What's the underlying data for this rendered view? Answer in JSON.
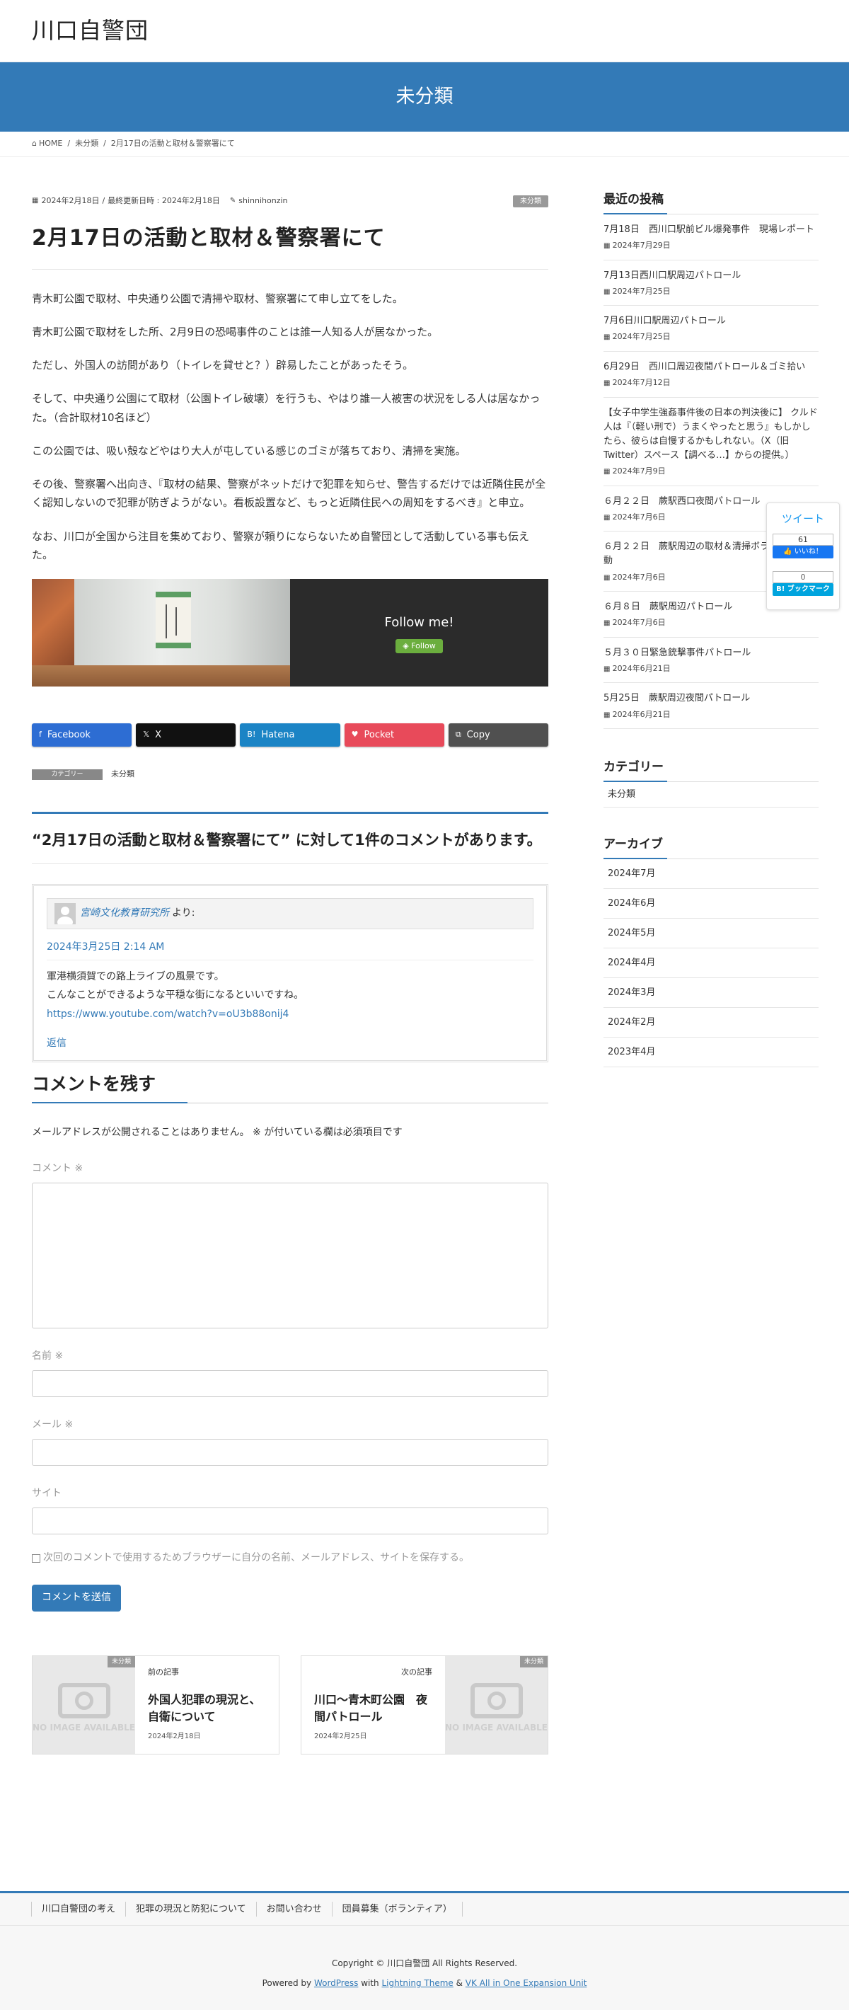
{
  "site": {
    "title": "川口自警団"
  },
  "banner": {
    "title": "未分類"
  },
  "breadcrumb": {
    "home_icon": "home-icon",
    "home": "HOME",
    "category": "未分類",
    "current": "2月17日の活動と取材＆警察署にて",
    "separator": "/"
  },
  "post": {
    "published": "2024年2月18日",
    "updated": "最終更新日時 : 2024年2月18日",
    "author": "shinnihonzin",
    "category_badge": "未分類",
    "title": "2月17日の活動と取材＆警察署にて",
    "paragraphs": [
      "青木町公園で取材、中央通り公園で清掃や取材、警察署にて申し立てをした。",
      "青木町公園で取材をした所、2月9日の恐喝事件のことは誰一人知る人が居なかった。",
      "ただし、外国人の訪問があり（トイレを貸せと？）辟易したことがあったそう。",
      "そして、中央通り公園にて取材（公園トイレ破壊）を行うも、やはり誰一人被害の状況をしる人は居なかった。（合計取材10名ほど）",
      "この公園では、吸い殻などやはり大人が屯している感じのゴミが落ちており、清掃を実施。",
      "その後、警察署へ出向き、『取材の結果、警察がネットだけで犯罪を知らせ、警告するだけでは近隣住民が全く認知しないので犯罪が防ぎようがない。看板設置など、もっと近隣住民への周知をするべき』と申立。",
      "なお、川口が全国から注目を集めており、警察が頼りにならないため自警団として活動している事も伝えた。"
    ],
    "follow": {
      "text": "Follow me!",
      "button": "Follow"
    },
    "share": [
      {
        "label": "Facebook",
        "color": "#2d6dd3",
        "icon": "facebook-icon",
        "glyph": "f"
      },
      {
        "label": "X",
        "color": "#111111",
        "icon": "x-icon",
        "glyph": "𝕏"
      },
      {
        "label": "Hatena",
        "color": "#1b84c5",
        "icon": "hatena-icon",
        "glyph": "B!"
      },
      {
        "label": "Pocket",
        "color": "#e84a5a",
        "icon": "pocket-icon",
        "glyph": "♥"
      },
      {
        "label": "Copy",
        "color": "#505050",
        "icon": "copy-icon",
        "glyph": "⧉"
      }
    ],
    "category_label": "カテゴリー",
    "category_value": "未分類"
  },
  "comments": {
    "title": "“2月17日の活動と取材＆警察署にて” に対して1件のコメントがあります。",
    "author": "宮崎文化教育研究所",
    "author_suffix": "より:",
    "date": "2024年3月25日 2:14 AM",
    "lines": [
      "軍港横須賀での路上ライブの風景です。",
      "こんなことができるような平穏な街になるといいですね。"
    ],
    "link": "https://www.youtube.com/watch?v=oU3b88onij4",
    "reply": "返信"
  },
  "form": {
    "title": "コメントを残す",
    "notes": "メールアドレスが公開されることはありません。 ※ が付いている欄は必須項目です",
    "comment_label": "コメント ※",
    "name_label": "名前 ※",
    "email_label": "メール ※",
    "site_label": "サイト",
    "save_label": "次回のコメントで使用するためブラウザーに自分の名前、メールアドレス、サイトを保存する。",
    "submit": "コメントを送信"
  },
  "post_nav": {
    "prev": {
      "label": "前の記事",
      "title": "外国人犯罪の現況と、自衛について",
      "date": "2024年2月18日",
      "badge": "未分類"
    },
    "next": {
      "label": "次の記事",
      "title": "川口〜青木町公園　夜間パトロール",
      "date": "2024年2月25日",
      "badge": "未分類"
    },
    "noimage": "NO IMAGE AVAILABLE"
  },
  "sidebar": {
    "recent_title": "最近の投稿",
    "recent": [
      {
        "title": "7月18日　西川口駅前ビル爆発事件　現場レポート",
        "date": "2024年7月29日"
      },
      {
        "title": "7月13日西川口駅周辺パトロール",
        "date": "2024年7月25日"
      },
      {
        "title": "7月6日川口駅周辺パトロール",
        "date": "2024年7月25日"
      },
      {
        "title": "6月29日　西川口周辺夜間パトロール＆ゴミ拾い",
        "date": "2024年7月12日"
      },
      {
        "title": "【女子中学生強姦事件後の日本の判決後に】 クルド人は『（軽い刑で）うまくやったと思う』もしかしたら、彼らは自慢するかもしれない。（X（旧Twitter）スペース【調べる…】からの提供。）",
        "date": "2024年7月9日"
      },
      {
        "title": "６月２２日　蕨駅西口夜間パトロール",
        "date": "2024年7月6日"
      },
      {
        "title": "６月２２日　蕨駅周辺の取材＆清掃ボランティア活動",
        "date": "2024年7月6日"
      },
      {
        "title": "６月８日　蕨駅周辺パトロール",
        "date": "2024年7月6日"
      },
      {
        "title": "５月３０日緊急銃撃事件パトロール",
        "date": "2024年6月21日"
      },
      {
        "title": "5月25日　蕨駅周辺夜間パトロール",
        "date": "2024年6月21日"
      }
    ],
    "category_title": "カテゴリー",
    "categories": [
      "未分類"
    ],
    "archive_title": "アーカイブ",
    "archives": [
      "2024年7月",
      "2024年6月",
      "2024年5月",
      "2024年4月",
      "2024年3月",
      "2024年2月",
      "2023年4月"
    ]
  },
  "floating_share": {
    "tweet": "ツイート",
    "fb_count": "61",
    "fb_like": "👍 いいね！",
    "hatena_count": "0",
    "hatena": "B! ブックマーク"
  },
  "footer": {
    "nav": [
      "川口自警団の考え",
      "犯罪の現況と防犯について",
      "お問い合わせ",
      "団員募集（ボランティア）"
    ],
    "copyright": "Copyright © 川口自警団 All Rights Reserved.",
    "powered_prefix": "Powered by ",
    "wordpress": "WordPress",
    "with": " with ",
    "theme": "Lightning Theme",
    "amp": " & ",
    "plugin": "VK All in One Expansion Unit"
  },
  "colors": {
    "accent": "#337ab7",
    "follow_green": "#6bae3e"
  }
}
